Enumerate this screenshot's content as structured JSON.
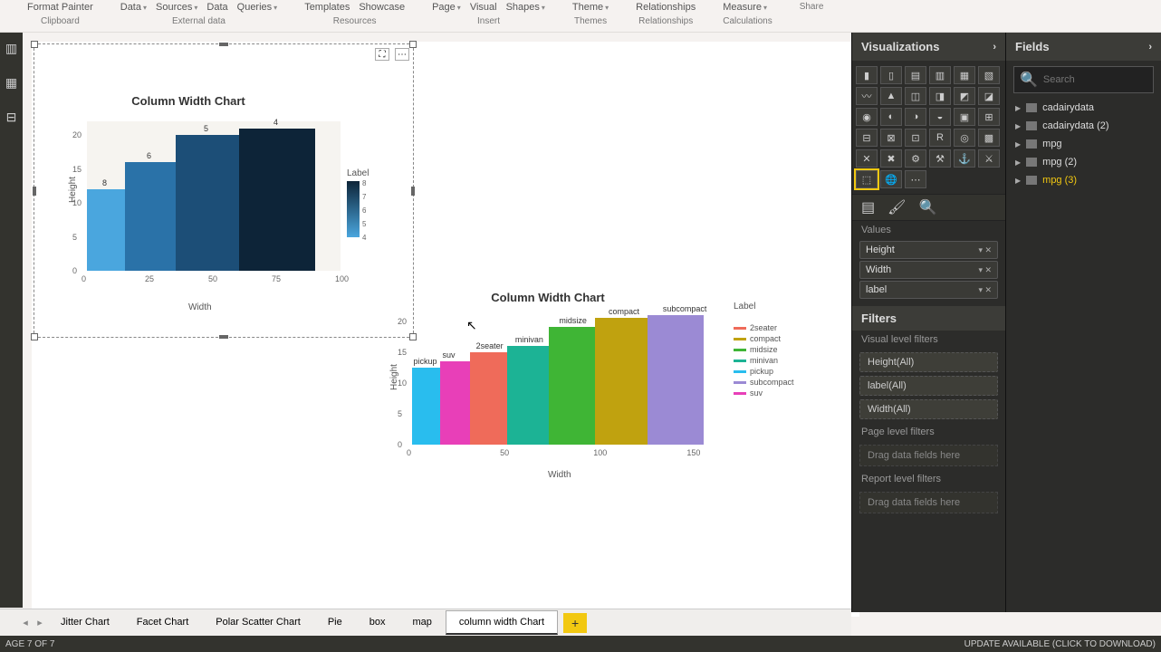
{
  "ribbon": {
    "clipboard": {
      "format_painter": "Format Painter",
      "label": "Clipboard"
    },
    "external": {
      "data": "Data",
      "sources": "Sources",
      "data2": "Data",
      "queries": "Queries",
      "label": "External data"
    },
    "resources": {
      "templates": "Templates",
      "showcase": "Showcase",
      "label": "Resources"
    },
    "insert": {
      "page": "Page",
      "visual": "Visual",
      "shapes": "Shapes",
      "label": "Insert"
    },
    "themes": {
      "theme": "Theme",
      "label": "Themes"
    },
    "relationships": {
      "rel": "Relationships",
      "label": "Relationships"
    },
    "calculations": {
      "measure": "Measure",
      "label": "Calculations"
    },
    "share": {
      "label": "Share"
    }
  },
  "chart_data": [
    {
      "type": "bar",
      "title": "Column Width Chart",
      "xlabel": "Width",
      "ylabel": "Height",
      "legend_title": "Label",
      "x_ticks": [
        0,
        25,
        50,
        75,
        100
      ],
      "y_ticks": [
        0,
        5,
        10,
        15,
        20
      ],
      "color_scale": {
        "min": 4,
        "max": 8,
        "ticks": [
          8,
          7,
          6,
          5,
          4
        ]
      },
      "bars": [
        {
          "label": 8,
          "width": 15,
          "height": 12,
          "color": "#4aa6de"
        },
        {
          "label": 6,
          "width": 20,
          "height": 16,
          "color": "#2a72a8"
        },
        {
          "label": 5,
          "width": 25,
          "height": 20,
          "color": "#1c4e77"
        },
        {
          "label": 4,
          "width": 30,
          "height": 21,
          "color": "#0d2438"
        }
      ]
    },
    {
      "type": "bar",
      "title": "Column Width Chart",
      "xlabel": "Width",
      "ylabel": "Height",
      "legend_title": "Label",
      "x_ticks": [
        0,
        50,
        100,
        150
      ],
      "y_ticks": [
        0,
        5,
        10,
        15,
        20
      ],
      "bars": [
        {
          "label": "pickup",
          "width": 15,
          "height": 12.5,
          "color": "#29bdee"
        },
        {
          "label": "suv",
          "width": 16,
          "height": 13.5,
          "color": "#e83fb8"
        },
        {
          "label": "2seater",
          "width": 20,
          "height": 15,
          "color": "#ef6b5a"
        },
        {
          "label": "minivan",
          "width": 22,
          "height": 16,
          "color": "#1cb395"
        },
        {
          "label": "midsize",
          "width": 25,
          "height": 19,
          "color": "#3fb535"
        },
        {
          "label": "compact",
          "width": 28,
          "height": 20.5,
          "color": "#c0a20f"
        },
        {
          "label": "subcompact",
          "width": 30,
          "height": 21,
          "color": "#9b8ad4"
        }
      ],
      "legend_order": [
        "2seater",
        "compact",
        "midsize",
        "minivan",
        "pickup",
        "subcompact",
        "suv"
      ],
      "legend_colors": {
        "2seater": "#ef6b5a",
        "compact": "#c0a20f",
        "midsize": "#3fb535",
        "minivan": "#1cb395",
        "pickup": "#29bdee",
        "subcompact": "#9b8ad4",
        "suv": "#e83fb8"
      }
    }
  ],
  "vis_pane": {
    "title": "Visualizations",
    "values_label": "Values",
    "wells": [
      "Height",
      "Width",
      "label"
    ],
    "filters_title": "Filters",
    "vlf_label": "Visual level filters",
    "vlf": [
      "Height(All)",
      "label(All)",
      "Width(All)"
    ],
    "plf_label": "Page level filters",
    "rlf_label": "Report level filters",
    "drag": "Drag data fields here"
  },
  "fields_pane": {
    "title": "Fields",
    "search_placeholder": "Search",
    "tables": [
      "cadairydata",
      "cadairydata (2)",
      "mpg",
      "mpg (2)",
      "mpg (3)"
    ],
    "selected": "mpg (3)"
  },
  "tabs": {
    "list": [
      "Jitter Chart",
      "Facet Chart",
      "Polar Scatter Chart",
      "Pie",
      "box",
      "map",
      "column width Chart"
    ],
    "active": "column width Chart"
  },
  "status": {
    "left": "AGE 7 OF 7",
    "right": "UPDATE AVAILABLE (CLICK TO DOWNLOAD)"
  }
}
